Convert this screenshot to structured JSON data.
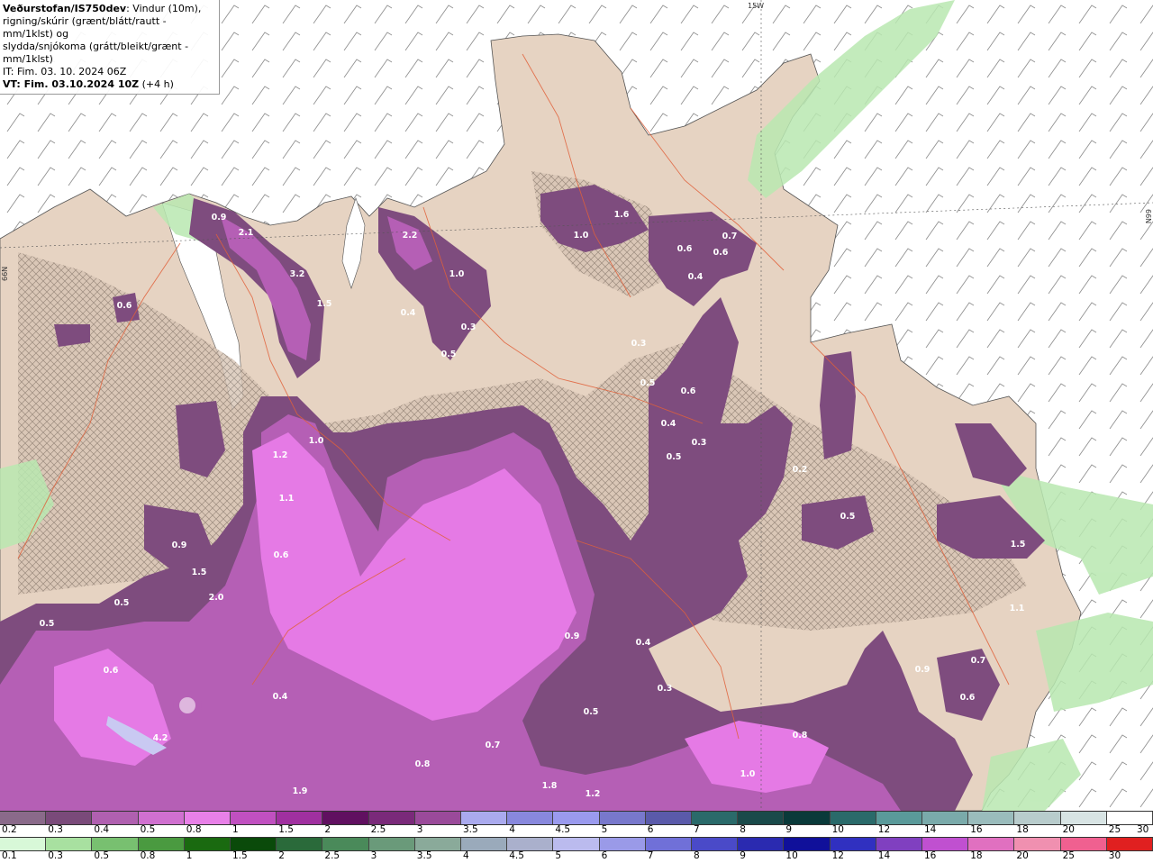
{
  "info": {
    "line1_bold": "Veðurstofan/IS750dev",
    "line1_rest": ": Vindur (10m),",
    "line2": "rigning/skúrir (grænt/blátt/rautt - mm/1klst) og",
    "line3": "slydda/snjókoma (grátt/bleikt/grænt - mm/1klst)",
    "line4": "IT: Fim. 03. 10. 2024 06Z",
    "line5_bold": "VT: Fim. 03.10.2024 10Z",
    "line5_rest": " (+4 h)"
  },
  "grid_labels": {
    "top": "15W",
    "right": "66N",
    "left": "66N"
  },
  "colorbar_snow": {
    "labels": [
      "0.2",
      "0.3",
      "0.4",
      "0.5",
      "0.8",
      "1",
      "1.5",
      "2",
      "2.5",
      "3",
      "3.5",
      "4",
      "4.5",
      "5",
      "6",
      "7",
      "8",
      "9",
      "10",
      "12",
      "14",
      "16",
      "18",
      "20",
      "25",
      "30"
    ],
    "colors": [
      "#8a6a8a",
      "#7a4a7a",
      "#b060b0",
      "#d070d0",
      "#e880e8",
      "#c050c0",
      "#a030a0",
      "#601060",
      "#7a2a7a",
      "#9a4a9a",
      "#aaaaee",
      "#8888dd",
      "#9a9aee",
      "#7878cc",
      "#5a5aaa",
      "#2a6a6a",
      "#1a4a4a",
      "#0a3a3a",
      "#2a6a6a",
      "#5a9a9a",
      "#7aaaaa",
      "#9abcbc",
      "#b8cccc",
      "#d8e4e4",
      "#ffffff"
    ]
  },
  "colorbar_rain": {
    "labels": [
      "0.1",
      "0.3",
      "0.5",
      "0.8",
      "1",
      "1.5",
      "2",
      "2.5",
      "3",
      "3.5",
      "4",
      "4.5",
      "5",
      "6",
      "7",
      "8",
      "9",
      "10",
      "12",
      "14",
      "16",
      "18",
      "20",
      "25",
      "30"
    ],
    "colors": [
      "#d8f8d8",
      "#a8e0a0",
      "#78c070",
      "#4a9a40",
      "#1a6a10",
      "#0a4a0a",
      "#2a6a3a",
      "#4a8a5a",
      "#6a9a7a",
      "#8aaa9a",
      "#9aaabb",
      "#aab0cc",
      "#bbbbee",
      "#9a9ae8",
      "#7070d8",
      "#4a4ac8",
      "#2a2ab0",
      "#10109a",
      "#3030c0",
      "#8040c0",
      "#c050d0",
      "#e070c0",
      "#f090b0",
      "#f06090",
      "#e02020"
    ]
  },
  "map_values": [
    "0.9",
    "2.1",
    "3.2",
    "1.5",
    "0.6",
    "2.2",
    "1.0",
    "0.4",
    "0.3",
    "0.5",
    "1.6",
    "1.0",
    "0.7",
    "0.6",
    "0.6",
    "0.4",
    "0.3",
    "0.5",
    "0.6",
    "0.4",
    "0.5",
    "0.3",
    "0.2",
    "0.5",
    "1.0",
    "1.2",
    "1.1",
    "0.6",
    "0.9",
    "1.5",
    "2.0",
    "0.5",
    "0.6",
    "4.2",
    "0.4",
    "1.9",
    "0.8",
    "1.8",
    "1.2",
    "0.7",
    "0.9",
    "0.4",
    "0.3",
    "0.8",
    "0.5",
    "1.5",
    "1.1",
    "0.7",
    "0.6",
    "0.9",
    "1.0",
    "0.5"
  ],
  "colors": {
    "sea": "#ffffff",
    "land": "#e6d3c2",
    "snow_light": "#7e4c7e",
    "snow_mid": "#b55fb5",
    "snow_bright": "#e57ae5",
    "snow_peak": "#c9c9f2",
    "rain_light": "#b8e8b0",
    "road": "#e0603a"
  }
}
